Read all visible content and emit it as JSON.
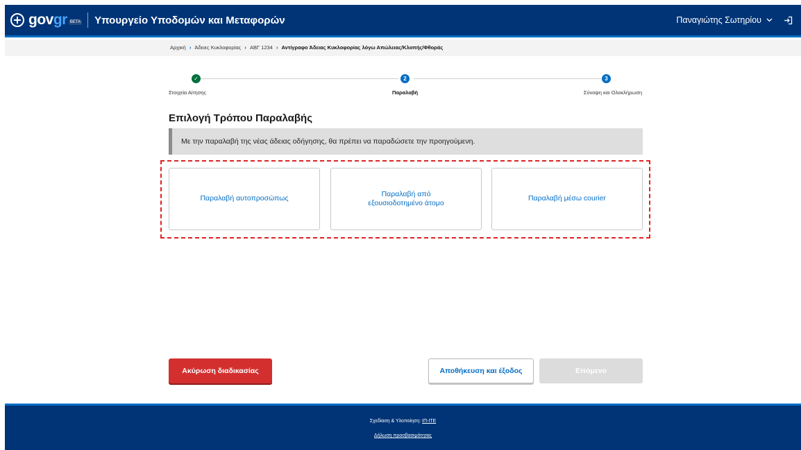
{
  "header": {
    "logo_main": "gov",
    "logo_accent": "gr",
    "logo_badge": "BETA",
    "ministry": "Υπουργείο Υποδομών και Μεταφορών",
    "user_name": "Παναγιώτης Σωτηρίου",
    "user_menu_icon": "chevron-down-icon",
    "logout_icon": "logout-icon"
  },
  "breadcrumb": {
    "items": [
      "Αρχική",
      "Άδειες Κυκλοφορίας",
      "ΑΒΓ 1234",
      "Αντίγραφο Άδειας Κυκλοφορίας λόγω Απώλειας/Κλοπής/Φθοράς"
    ]
  },
  "stepper": {
    "steps": [
      {
        "label": "Στοιχεία Αίτησης",
        "state": "done",
        "marker": "✓"
      },
      {
        "label": "Παραλαβή",
        "state": "active",
        "marker": "2"
      },
      {
        "label": "Σύνοψη και Ολοκλήρωση",
        "state": "pending",
        "marker": "3"
      }
    ]
  },
  "main": {
    "title": "Επιλογή Τρόπου Παραλαβής",
    "notice": "Με την παραλαβή της νέας άδειας οδήγησης, θα πρέπει να παραδώσετε την προηγούμενη.",
    "options": [
      {
        "label": "Παραλαβή αυτοπροσώπως"
      },
      {
        "label_line1": "Παραλαβή από",
        "label_line2": "εξουσιοδοτημένο άτομο"
      },
      {
        "label": "Παραλαβή μέσω courier"
      }
    ]
  },
  "actions": {
    "cancel": "Ακύρωση διαδικασίας",
    "save_exit": "Αποθήκευση και έξοδος",
    "next": "Επόμενο"
  },
  "footer": {
    "design_prefix": "Σχεδίαση & Υλοποίηση: ",
    "design_link": "ΙΠ-ΙΤΕ",
    "accessibility": "Δήλωση προσβασιμότητας"
  },
  "colors": {
    "brand": "#003476",
    "accent": "#046ec5",
    "danger": "#d32f2f",
    "success": "#00703c",
    "highlight": "#e02020"
  }
}
